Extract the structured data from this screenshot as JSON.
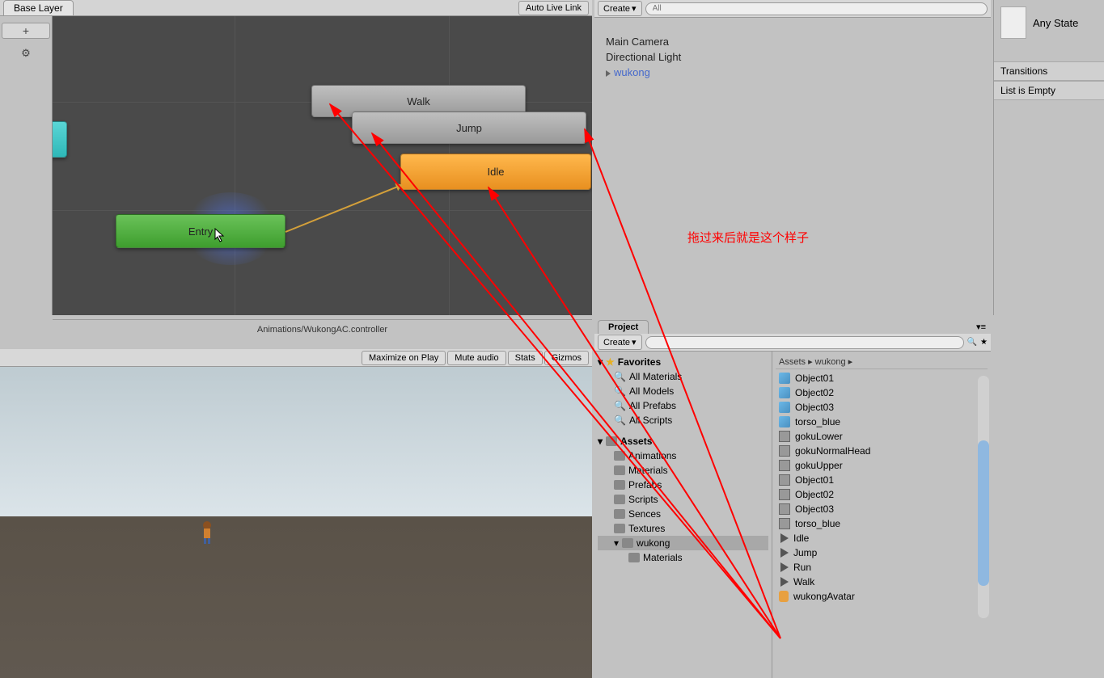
{
  "animator": {
    "breadcrumb": "Base Layer",
    "auto_link": "Auto Live Link",
    "status_path": "Animations/WukongAC.controller",
    "plus_label": "+",
    "nodes": {
      "walk": "Walk",
      "jump": "Jump",
      "idle": "Idle",
      "entry": "Entry"
    }
  },
  "hierarchy": {
    "create_label": "Create",
    "search_placeholder": "All",
    "items": [
      {
        "label": "Main Camera",
        "link": false
      },
      {
        "label": "Directional Light",
        "link": false
      },
      {
        "label": "wukong",
        "link": true
      }
    ]
  },
  "inspector": {
    "title": "Any State",
    "transitions_label": "Transitions",
    "empty_label": "List is Empty"
  },
  "game_toolbar": {
    "maximize": "Maximize on Play",
    "mute": "Mute audio",
    "stats": "Stats",
    "gizmos": "Gizmos"
  },
  "project": {
    "tab_label": "Project",
    "create_label": "Create",
    "search_placeholder": "",
    "favorites_label": "Favorites",
    "favorites": [
      "All Materials",
      "All Models",
      "All Prefabs",
      "All Scripts"
    ],
    "assets_label": "Assets",
    "folders": [
      "Animations",
      "Materials",
      "Prefabs",
      "Scripts",
      "Sences",
      "Textures",
      "wukong"
    ],
    "subfolder": "Materials",
    "breadcrumb": "Assets ▸ wukong ▸",
    "assets": [
      {
        "name": "Object01",
        "type": "cube"
      },
      {
        "name": "Object02",
        "type": "cube"
      },
      {
        "name": "Object03",
        "type": "cube"
      },
      {
        "name": "torso_blue",
        "type": "cube"
      },
      {
        "name": "gokuLower",
        "type": "mesh"
      },
      {
        "name": "gokuNormalHead",
        "type": "mesh"
      },
      {
        "name": "gokuUpper",
        "type": "mesh"
      },
      {
        "name": "Object01",
        "type": "mesh"
      },
      {
        "name": "Object02",
        "type": "mesh"
      },
      {
        "name": "Object03",
        "type": "mesh"
      },
      {
        "name": "torso_blue",
        "type": "mesh"
      },
      {
        "name": "Idle",
        "type": "anim"
      },
      {
        "name": "Jump",
        "type": "anim"
      },
      {
        "name": "Run",
        "type": "anim"
      },
      {
        "name": "Walk",
        "type": "anim"
      },
      {
        "name": "wukongAvatar",
        "type": "avatar"
      }
    ]
  },
  "annotation": {
    "text": "拖过来后就是这个样子"
  }
}
